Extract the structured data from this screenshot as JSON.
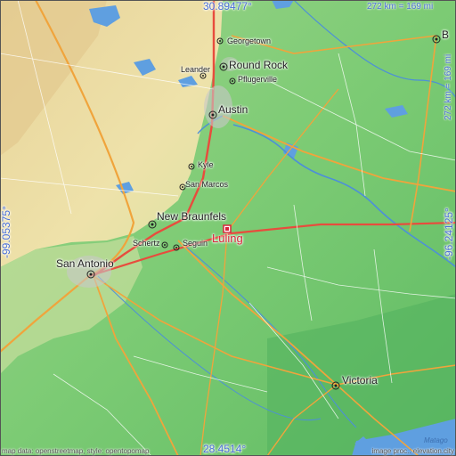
{
  "map": {
    "place": "Luling",
    "coords": {
      "top": "30.89477°",
      "bottom": "28.4514°",
      "left": "-99.05375°",
      "right": "-96.24125°"
    },
    "scale": {
      "horizontal": "272 km = 169 mi",
      "vertical": "272 km = 169 mi"
    },
    "credits": {
      "left": "map data: openstreetmap, style: opentopomap",
      "right": "image proc.: elevation.city"
    },
    "colors": {
      "highlight": "#d8243a",
      "coordinate_text": "#4a6fd6",
      "lowland": "#7fc87a",
      "highland": "#e9dca0",
      "water": "#5f9fe0"
    },
    "cities": [
      {
        "id": "georgetown",
        "name": "Georgetown",
        "size": "small"
      },
      {
        "id": "round-rock",
        "name": "Round Rock",
        "size": "big"
      },
      {
        "id": "leander",
        "name": "Leander",
        "size": "small"
      },
      {
        "id": "pflugerville",
        "name": "Pflugerville",
        "size": "small"
      },
      {
        "id": "austin",
        "name": "Austin",
        "size": "big"
      },
      {
        "id": "kyle",
        "name": "Kyle",
        "size": "small"
      },
      {
        "id": "san-marcos",
        "name": "San Marcos",
        "size": "small"
      },
      {
        "id": "new-braunfels",
        "name": "New Braunfels",
        "size": "big"
      },
      {
        "id": "schertz",
        "name": "Schertz",
        "size": "small"
      },
      {
        "id": "seguin",
        "name": "Seguin",
        "size": "small"
      },
      {
        "id": "san-antonio",
        "name": "San Antonio",
        "size": "big"
      },
      {
        "id": "victoria",
        "name": "Victoria",
        "size": "big"
      },
      {
        "id": "bryan",
        "name": "B",
        "size": "big"
      }
    ],
    "water_label": "Matago"
  }
}
